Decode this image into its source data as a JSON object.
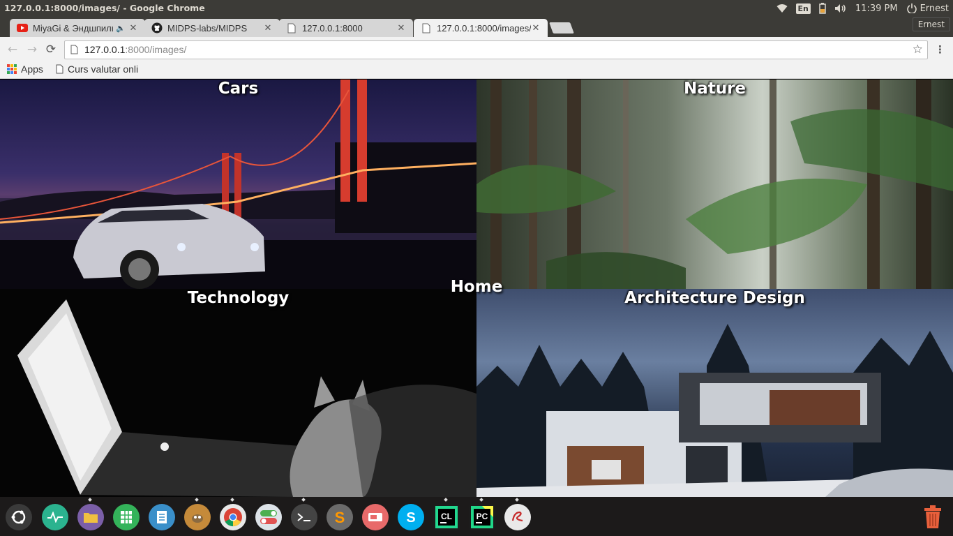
{
  "system_bar": {
    "window_title": "127.0.0.1:8000/images/ - Google Chrome",
    "keyboard_layout": "En",
    "clock": "11:39 PM",
    "user": "Ernest",
    "user_tooltip": "Ernest"
  },
  "tabs": [
    {
      "title": "MiyaGi & Эндшпиль",
      "favicon": "youtube-icon",
      "audio": "🔈",
      "active": false
    },
    {
      "title": "MIDPS-labs/MIDPS",
      "favicon": "github-icon",
      "active": false
    },
    {
      "title": "127.0.0.1:8000",
      "favicon": "page-icon",
      "active": false
    },
    {
      "title": "127.0.0.1:8000/images/",
      "favicon": "page-icon",
      "active": true
    }
  ],
  "omnibox": {
    "host": "127.0.0.1",
    "path": ":8000/images/"
  },
  "bookmarks": [
    {
      "label": "Apps",
      "icon": "apps-grid-icon"
    },
    {
      "label": "Curs valutar onli",
      "icon": "page-icon"
    }
  ],
  "page": {
    "home_link": "Home",
    "tiles": {
      "cars": "Cars",
      "nature": "Nature",
      "technology": "Technology",
      "architecture": "Architecture Design"
    }
  },
  "launcher": [
    {
      "name": "ubuntu-dash-icon",
      "color": "#3a3a3a"
    },
    {
      "name": "system-monitor-icon",
      "color": "#2bb38f"
    },
    {
      "name": "files-icon",
      "color": "#7b5fa8"
    },
    {
      "name": "spreadsheet-icon",
      "color": "#34b35a"
    },
    {
      "name": "documents-icon",
      "color": "#3a8fc9"
    },
    {
      "name": "gimp-icon",
      "color": "#c58a3a"
    },
    {
      "name": "chrome-icon",
      "color": "#db4437"
    },
    {
      "name": "settings-toggle-icon",
      "color": "#9ab"
    },
    {
      "name": "terminal-icon",
      "color": "#444"
    },
    {
      "name": "sublime-text-icon",
      "color": "#6b6b6b"
    },
    {
      "name": "recorder-icon",
      "color": "#e86a6a"
    },
    {
      "name": "skype-icon",
      "color": "#00aff0"
    },
    {
      "name": "clion-icon",
      "color": "#1c1c1c"
    },
    {
      "name": "pycharm-icon",
      "color": "#1c1c1c"
    },
    {
      "name": "editor-icon",
      "color": "#e9e9e9"
    }
  ],
  "colors": {
    "system_bar": "#3c3b37",
    "tab_active": "#f2f2f2",
    "tab_inactive": "#d6d6d6",
    "launcher_bg": "#1c1a1a",
    "title_text": "#ffffff"
  }
}
